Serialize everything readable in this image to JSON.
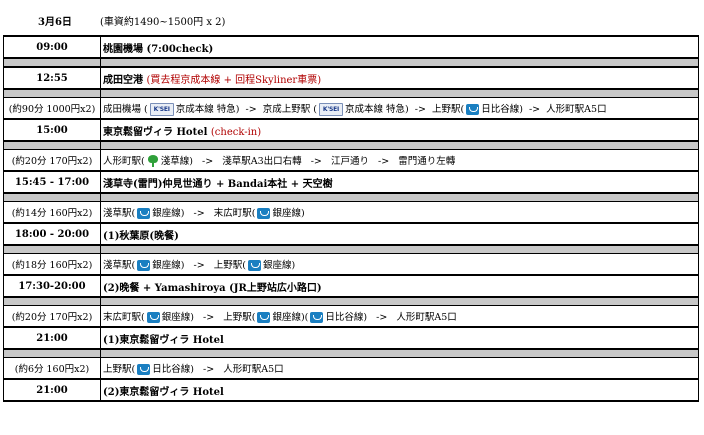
{
  "header": {
    "date": "3月6日",
    "note": "(車資約1490~1500円 x 2)"
  },
  "rows": {
    "r1": {
      "time": "09:00",
      "text": "桃園機場 (7:00check)"
    },
    "r2": {
      "time": "12:55",
      "text": "成田空港 ",
      "note": "(買去程京成本線 + 回程Skyliner車票)"
    },
    "r3": {
      "fare": "(約90分 1000円x2)",
      "a": "成田機場 (",
      "a2": "京成本線 特急)",
      "arrow1": "->",
      "b": "京成上野駅 (",
      "b2": "京成本線 特急)",
      "arrow2": "->",
      "c": "上野駅(",
      "c2": "日比谷線)",
      "arrow3": "->",
      "d": "人形町駅A5口",
      "keisei": "K'SEI"
    },
    "r4": {
      "time": "15:00",
      "text": "東京鬆留ヴィラ Hotel ",
      "note": "(check-in)"
    },
    "r5": {
      "fare": "(約20分 170円x2)",
      "a": "人形町駅(",
      "a2": "淺草線)",
      "arrow1": "->",
      "b": "淺草駅A3出口右轉",
      "arrow2": "->",
      "c": "江戸通り",
      "arrow3": "->",
      "d": "雷門通り左轉"
    },
    "r6": {
      "time": "15:45 - 17:00",
      "text": "淺草寺(雷門)仲見世通り + Bandai本社 + 天空樹"
    },
    "r7": {
      "fare": "(約14分 160円x2)",
      "a": "淺草駅(",
      "a2": "銀座線)",
      "arrow1": "->",
      "b": "末広町駅(",
      "b2": "銀座線)"
    },
    "r8": {
      "time": "18:00 - 20:00",
      "text": "(1)秋葉原(晚餐)"
    },
    "r9": {
      "fare": "(約18分 160円x2)",
      "a": "淺草駅(",
      "a2": "銀座線)",
      "arrow1": "->",
      "b": "上野駅(",
      "b2": "銀座線)"
    },
    "r10": {
      "time": "17:30-20:00",
      "text": "(2)晚餐 + Yamashiroya (JR上野站広小路口)"
    },
    "r11": {
      "fare": "(約20分 170円x2)",
      "a": "末広町駅(",
      "a2": "銀座線)",
      "arrow1": "->",
      "b": "上野駅(",
      "b2": "銀座線)(",
      "b3": "日比谷線)",
      "arrow2": "->",
      "c": "人形町駅A5口"
    },
    "r12": {
      "time": "21:00",
      "text": "(1)東京鬆留ヴィラ Hotel"
    },
    "r13": {
      "fare": "(約6分 160円x2)",
      "a": "上野駅(",
      "a2": "日比谷線)",
      "arrow1": "->",
      "b": "人形町駅A5口"
    },
    "r14": {
      "time": "21:00",
      "text": "(2)東京鬆留ヴィラ Hotel"
    }
  }
}
